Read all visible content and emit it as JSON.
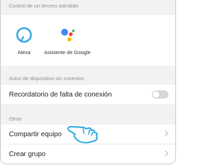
{
  "third_party": {
    "header": "Control de un tercero admitido",
    "items": [
      {
        "label": "Alexa",
        "icon": "alexa-icon",
        "color": "#31A8E0"
      },
      {
        "label": "Asistente de Google",
        "icon": "google-assistant-icon",
        "color": "#4285F4"
      }
    ]
  },
  "offline": {
    "header": "Aviso de dispositivo sin conexión",
    "reminder_label": "Recordatorio de falta de conexión",
    "toggle_on": false
  },
  "others": {
    "header": "Otros",
    "share_label": "Compartir equipo",
    "group_label": "Crear grupo"
  }
}
